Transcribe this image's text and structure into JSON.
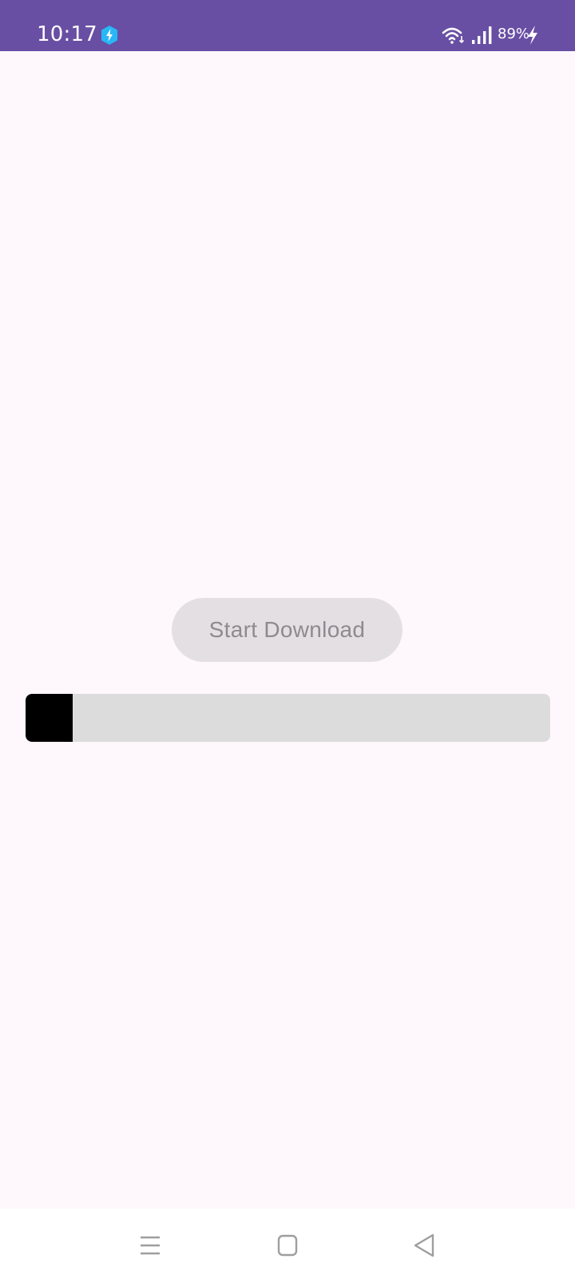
{
  "status_bar": {
    "time": "10:17",
    "battery_percent": "89%",
    "icons": [
      "shield-bolt-icon",
      "wifi-icon",
      "signal-icon",
      "charging-bolt-icon"
    ]
  },
  "main": {
    "start_button_label": "Start Download",
    "progress_fraction": 0.09
  },
  "nav_bar": {
    "icons": [
      "recent-apps-icon",
      "home-icon",
      "back-icon"
    ]
  },
  "colors": {
    "status_bar": "#684fa3",
    "background": "#fef8fd",
    "button_bg": "#e3dfe3",
    "button_text": "#8e8a8e",
    "progress_track": "#dcdcdc",
    "progress_fill": "#000000",
    "shield": "#29b6f6"
  }
}
